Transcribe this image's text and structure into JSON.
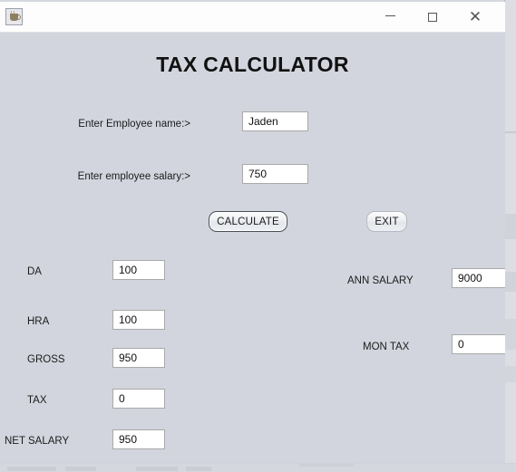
{
  "window": {
    "app_icon": "java-coffee-cup-icon",
    "title": "",
    "controls": {
      "minimize": "–",
      "maximize": "□",
      "close": "✕"
    }
  },
  "main": {
    "page_title": "TAX CALCULATOR",
    "inputs": [
      {
        "label": "Enter Employee name:>",
        "value": "Jaden"
      },
      {
        "label": "Enter employee salary:>",
        "value": "750"
      }
    ],
    "buttons": {
      "calculate": "CALCULATE",
      "exit": "EXIT"
    },
    "results_left": [
      {
        "label": "DA",
        "value": "100"
      },
      {
        "label": "HRA",
        "value": "100"
      },
      {
        "label": "GROSS",
        "value": "950"
      },
      {
        "label": "TAX",
        "value": "0"
      },
      {
        "label": "NET SALARY",
        "value": "950"
      }
    ],
    "results_right": [
      {
        "label": "ANN SALARY",
        "value": "9000"
      },
      {
        "label": "MON TAX",
        "value": "0"
      }
    ]
  },
  "colors": {
    "panel_background": "#d2d5de",
    "titlebar_background": "#fdfdfd",
    "field_background": "#ffffff",
    "field_border": "#a9a9a9",
    "text": "#1c1c1c",
    "focus_border": "#4a4f58"
  }
}
